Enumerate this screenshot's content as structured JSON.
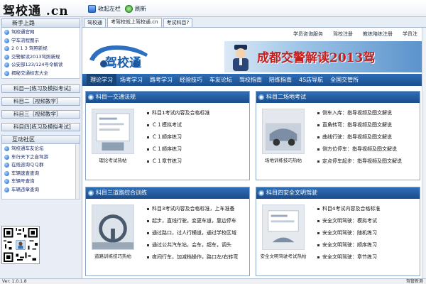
{
  "app": {
    "logo_text": "驾校通 .cn",
    "toolbar": {
      "fav_label": "收起左栏",
      "refresh_label": "刷新"
    },
    "version": "Ver: 1.0.1.8",
    "status_right": "驾管新测"
  },
  "sidebar": {
    "section1_title": "新手上路",
    "section1_items": [
      "驾校通官网",
      "学车流程图示",
      "2 0 1 3 驾照新规",
      "交警解读2013驾照新规",
      "公安部123/124号令解读",
      "揭秘交通标志大全"
    ],
    "buttons": [
      "科目一[练习及模拟考试]",
      "科目二［视频教学］",
      "科目三［视频教学］",
      "科目四[练习及模拟考试]"
    ],
    "section2_title": "互动社区",
    "section2_items": [
      "驾校通车友论坛",
      "车行天下之自驾游",
      "在线咨询ＱＱ群",
      "车辆速查查询",
      "车辆号查询",
      "车辆违章查询"
    ]
  },
  "tabs": [
    "驾校通",
    "考驾校就上驾校通.cn",
    "考试科目?"
  ],
  "content": {
    "toplinks": [
      "学员咨询服务",
      "驾校注册",
      "教练陪练注册",
      "学员注"
    ],
    "hero_logo_text": "驾校通",
    "banner_text": "成都交警解读2013驾",
    "nav": [
      "理论学习",
      "场考学习",
      "路考学习",
      "经验技巧",
      "车友论坛",
      "驾校指南",
      "陪练指南",
      "4S店导航",
      "全国交管所"
    ],
    "panels": [
      {
        "title": "科目一交通法规",
        "caption": "理论考试热帖",
        "links": [
          "科目1考试内容及合格标准",
          "Ｃ１模拟考试",
          "Ｃ１顺序练习",
          "Ｃ１顺序练习",
          "Ｃ１章节练习"
        ]
      },
      {
        "title": "科目二场地考试",
        "caption": "场地训练技巧热帖",
        "links": [
          "侧车入库：指导视频及图文解说",
          "直角转弯：指导视频及图文解说",
          "曲线行驶：指导视频及图文解说",
          "侧方位停车：指导视频及图文解说",
          "定点停车起步：指导视频及图文解说"
        ]
      },
      {
        "title": "科目三道路综合训练",
        "caption": "道路训练技巧热帖",
        "links": [
          "科目3考试内容及合格标准，上车准备",
          "起步，直线行驶，变更车道，靠边停车",
          "通过路口，过人行横道，通过学校区域",
          "通过公共汽车站，会车，超车，调头",
          "夜间行车，加减档操作，路口左/右转弯"
        ]
      },
      {
        "title": "科目四安全文明驾驶",
        "caption": "安全文明驾驶考试热帖",
        "links": [
          "科目4考试内容及合格标准",
          "安全文明驾驶：模拟考试",
          "安全文明驾驶：随机练习",
          "安全文明驾驶：顺序练习",
          "安全文明驾驶：章节练习"
        ]
      }
    ]
  }
}
